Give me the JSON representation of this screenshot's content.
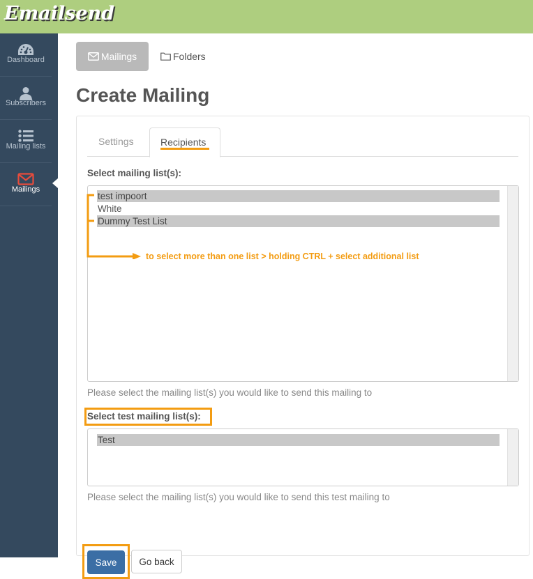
{
  "app": {
    "logo": "Emailsend"
  },
  "sidebar": {
    "items": [
      {
        "label": "Dashboard",
        "icon": "dashboard-icon",
        "active": false
      },
      {
        "label": "Subscribers",
        "icon": "user-icon",
        "active": false
      },
      {
        "label": "Mailing lists",
        "icon": "list-icon",
        "active": false
      },
      {
        "label": "Mailings",
        "icon": "envelope-icon",
        "active": true
      }
    ]
  },
  "subnav": {
    "mailings": "Mailings",
    "folders": "Folders"
  },
  "page": {
    "title": "Create Mailing"
  },
  "tabs": {
    "settings": "Settings",
    "recipients": "Recipients"
  },
  "form": {
    "mailing_lists_label": "Select mailing list(s):",
    "mailing_lists": [
      {
        "label": "test impoort",
        "selected": true
      },
      {
        "label": "White",
        "selected": false
      },
      {
        "label": "Dummy Test List",
        "selected": true
      }
    ],
    "mailing_lists_help": "Please select the mailing list(s) you would like to send this mailing to",
    "test_lists_label": "Select test mailing list(s):",
    "test_lists": [
      {
        "label": "Test",
        "selected": true
      }
    ],
    "test_lists_help": "Please select the mailing list(s) you would like to send this test mailing to",
    "save": "Save",
    "go_back": "Go back"
  },
  "annotation": {
    "text": "to select more than one list > holding CTRL + select additional list",
    "color": "#f39c12"
  },
  "colors": {
    "topbar": "#aece7f",
    "sidebar": "#34495e",
    "accent_active": "#e74c3c",
    "primary_button": "#3b6ea5",
    "highlight": "#f39c12"
  }
}
